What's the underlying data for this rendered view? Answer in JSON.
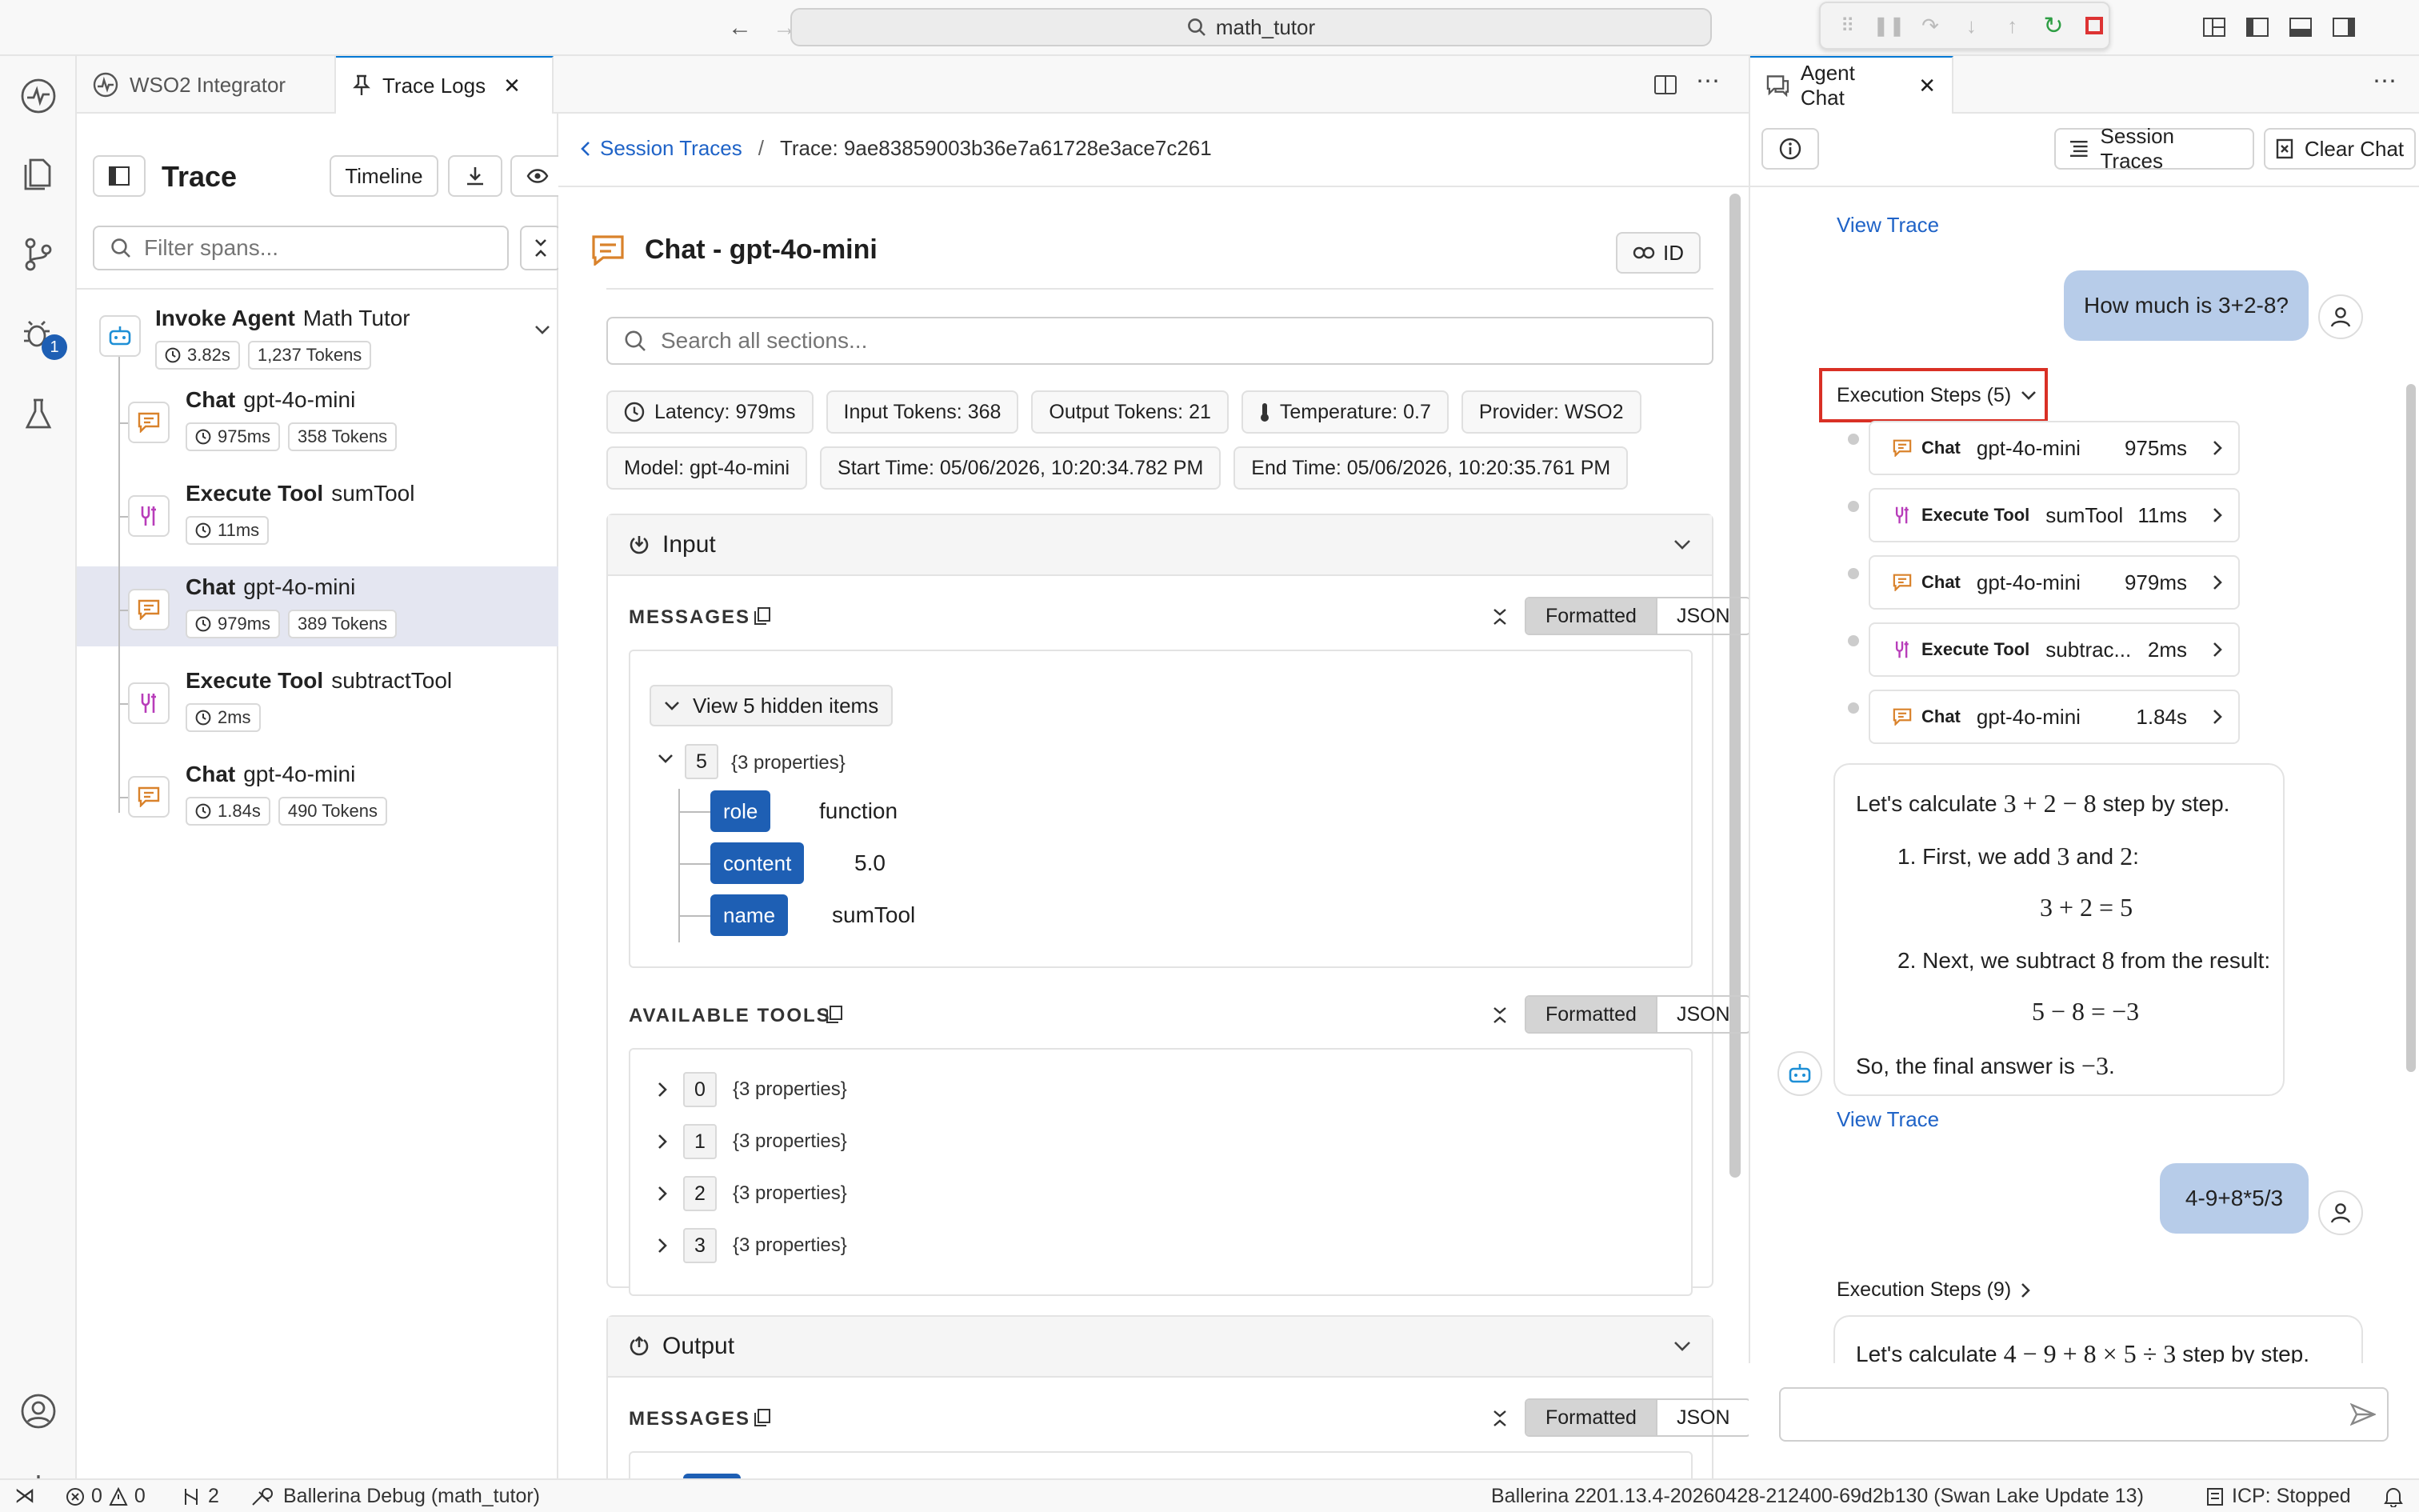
{
  "titlebar": {
    "command_center": "math_tutor"
  },
  "activity": {
    "debug_badge": "1"
  },
  "tabs": [
    {
      "label": "WSO2 Integrator"
    },
    {
      "label": "Trace Logs"
    }
  ],
  "trace_panel": {
    "title": "Trace",
    "timeline_label": "Timeline",
    "filter_placeholder": "Filter spans...",
    "root": {
      "kind": "Invoke Agent",
      "name": "Math Tutor",
      "duration": "3.82s",
      "tokens": "1,237 Tokens"
    },
    "items": [
      {
        "kind": "Chat",
        "name": "gpt-4o-mini",
        "duration": "975ms",
        "tokens": "358 Tokens"
      },
      {
        "kind": "Execute Tool",
        "name": "sumTool",
        "duration": "11ms",
        "tokens": ""
      },
      {
        "kind": "Chat",
        "name": "gpt-4o-mini",
        "duration": "979ms",
        "tokens": "389 Tokens"
      },
      {
        "kind": "Execute Tool",
        "name": "subtractTool",
        "duration": "2ms",
        "tokens": ""
      },
      {
        "kind": "Chat",
        "name": "gpt-4o-mini",
        "duration": "1.84s",
        "tokens": "490 Tokens"
      }
    ]
  },
  "breadcrumb": {
    "back": "Session Traces",
    "sep": "/",
    "current": "Trace: 9ae83859003b36e7a61728e3ace7c261"
  },
  "span": {
    "title": "Chat - gpt-4o-mini",
    "id_label": "ID",
    "search_placeholder": "Search all sections...",
    "chips": [
      "Latency: 979ms",
      "Input Tokens: 368",
      "Output Tokens: 21",
      "Temperature: 0.7",
      "Provider: WSO2",
      "Model: gpt-4o-mini",
      "Start Time: 05/06/2026, 10:20:34.782 PM",
      "End Time: 05/06/2026, 10:20:35.761 PM"
    ]
  },
  "input": {
    "title": "Input",
    "messages_label": "MESSAGES",
    "formatted": "Formatted",
    "json": "JSON",
    "hidden": "View 5 hidden items",
    "entry_index": "5",
    "entry_props": "{3 properties}",
    "fields": [
      {
        "key": "role",
        "value": "function"
      },
      {
        "key": "content",
        "value": "5.0"
      },
      {
        "key": "name",
        "value": "sumTool"
      }
    ],
    "tools_label": "AVAILABLE TOOLS",
    "tools": [
      {
        "index": "0",
        "props": "{3 properties}"
      },
      {
        "index": "1",
        "props": "{3 properties}"
      },
      {
        "index": "2",
        "props": "{3 properties}"
      },
      {
        "index": "3",
        "props": "{3 properties}"
      }
    ]
  },
  "output": {
    "title": "Output",
    "messages_label": "MESSAGES",
    "formatted": "Formatted",
    "json": "JSON"
  },
  "chat": {
    "tab_label": "Agent Chat",
    "session_traces": "Session Traces",
    "clear_chat": "Clear Chat",
    "view_trace": "View Trace",
    "user_msg_1": "How much is 3+2-8?",
    "steps_label": "Execution Steps (5)",
    "steps": [
      {
        "kind": "Chat",
        "name": "gpt-4o-mini",
        "duration": "975ms"
      },
      {
        "kind": "Execute Tool",
        "name": "sumTool",
        "duration": "11ms"
      },
      {
        "kind": "Chat",
        "name": "gpt-4o-mini",
        "duration": "979ms"
      },
      {
        "kind": "Execute Tool",
        "name": "subtrac...",
        "duration": "2ms"
      },
      {
        "kind": "Chat",
        "name": "gpt-4o-mini",
        "duration": "1.84s"
      }
    ],
    "answer": {
      "intro_pre": "Let's calculate",
      "intro_expr": "3 + 2 − 8",
      "intro_post": "step by step.",
      "step1_pre": "1. First, we add",
      "step1_a": "3",
      "step1_and": "and",
      "step1_b": "2",
      "step1_colon": ":",
      "eq1": "3 + 2 = 5",
      "step2_pre": "2. Next, we subtract",
      "step2_a": "8",
      "step2_post": "from the result:",
      "eq2": "5 − 8 = −3",
      "final_pre": "So, the final answer is",
      "final_val": "−3",
      "final_dot": "."
    },
    "view_trace_2": "View Trace",
    "user_msg_2": "4-9+8*5/3",
    "steps2_label": "Execution Steps (9)",
    "answer2_pre": "Let's calculate",
    "answer2_expr": "4 − 9 + 8 × 5 ÷ 3",
    "answer2_post": "step by step."
  },
  "statusbar": {
    "errors": "0",
    "warnings": "0",
    "ports": "2",
    "debug": "Ballerina Debug (math_tutor)",
    "version": "Ballerina 2201.13.4-20260428-212400-69d2b130 (Swan Lake Update 13)",
    "icp": "ICP: Stopped"
  },
  "colors": {
    "accent": "#1e5fb4",
    "selection": "#e4e6f1",
    "user_bubble": "#b7cce9",
    "highlight_border": "#d93025",
    "chat_icon": "#d9822b",
    "tool_icon": "#b83dba"
  }
}
